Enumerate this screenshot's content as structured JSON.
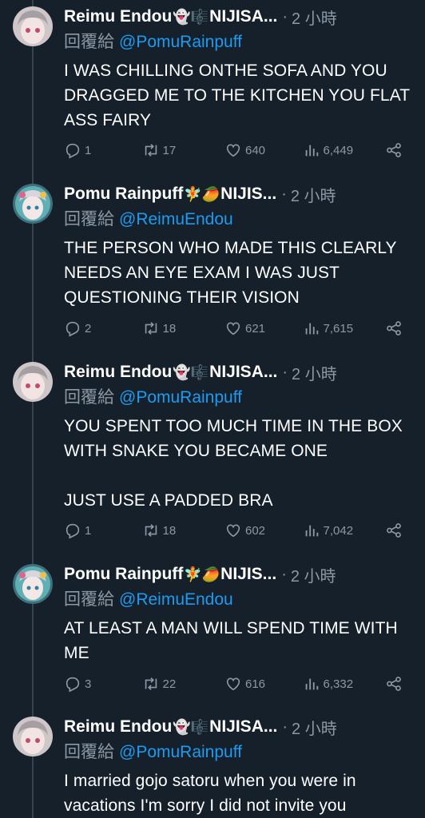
{
  "colors": {
    "background": "#15202b",
    "text": "#ffffff",
    "muted": "#8b98a5",
    "mention": "#1d9bf0"
  },
  "reply_label": "回覆給",
  "tweets": [
    {
      "author": "Reimu Endou",
      "author_emojis": "👻🎼",
      "handle_suffix": "NIJISA...",
      "time": "2 小時",
      "reply_to": "@PomuRainpuff",
      "text": "I WAS CHILLING ONTHE SOFA AND YOU DRAGGED ME TO THE KITCHEN YOU FLAT ASS FAIRY",
      "replies": "1",
      "retweets": "17",
      "likes": "640",
      "views": "6,449"
    },
    {
      "author": "Pomu Rainpuff",
      "author_emojis": "🧚🥭",
      "handle_suffix": "NIJIS...",
      "time": "2 小時",
      "reply_to": "@ReimuEndou",
      "text": "THE PERSON WHO MADE THIS CLEARLY NEEDS AN EYE EXAM I WAS JUST QUESTIONING THEIR VISION",
      "replies": "2",
      "retweets": "18",
      "likes": "621",
      "views": "7,615"
    },
    {
      "author": "Reimu Endou",
      "author_emojis": "👻🎼",
      "handle_suffix": "NIJISA...",
      "time": "2 小時",
      "reply_to": "@PomuRainpuff",
      "text": "YOU SPENT TOO MUCH TIME IN THE BOX WITH SNAKE YOU BECAME ONE\n\nJUST USE A PADDED BRA",
      "replies": "1",
      "retweets": "18",
      "likes": "602",
      "views": "7,042"
    },
    {
      "author": "Pomu Rainpuff",
      "author_emojis": "🧚🥭",
      "handle_suffix": "NIJIS...",
      "time": "2 小時",
      "reply_to": "@ReimuEndou",
      "text": "AT LEAST A MAN WILL SPEND TIME WITH ME",
      "replies": "3",
      "retweets": "22",
      "likes": "616",
      "views": "6,332"
    },
    {
      "author": "Reimu Endou",
      "author_emojis": "👻🎼",
      "handle_suffix": "NIJISA...",
      "time": "2 小時",
      "reply_to": "@PomuRainpuff",
      "text": "I married gojo satoru when you were in vacations I'm sorry I did not invite you"
    }
  ]
}
